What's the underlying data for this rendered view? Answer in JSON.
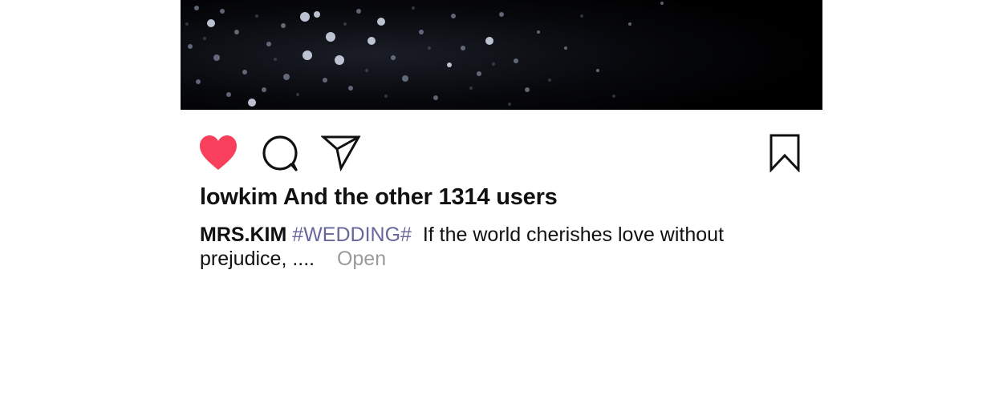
{
  "post": {
    "image_description": "dark photo with bokeh sparkles",
    "likes_text": "lowkim And the other 1314 users",
    "caption": {
      "username": "MRS.KIM",
      "hashtag": "#WEDDING#",
      "text_line1": "If the world cherishes love without",
      "text_line2": "prejudice, ....",
      "more_label": "Open"
    }
  },
  "actions": {
    "like_icon": "heart-filled-icon",
    "comment_icon": "comment-bubble-icon",
    "share_icon": "paper-plane-icon",
    "save_icon": "bookmark-icon"
  },
  "colors": {
    "like": "#f83f5c",
    "hashtag": "#66679a",
    "more": "#9a9a9a",
    "text": "#111111"
  }
}
